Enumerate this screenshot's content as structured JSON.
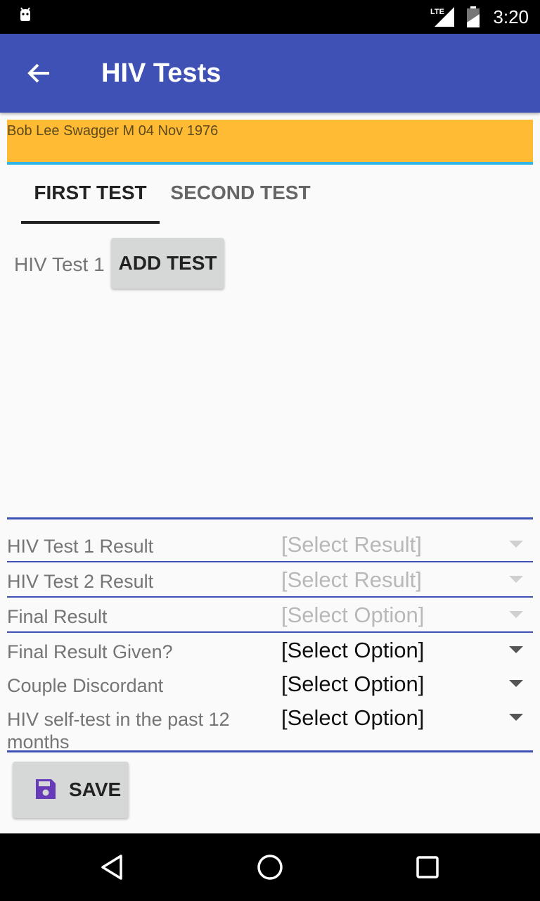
{
  "status_bar": {
    "network": "LTE",
    "time": "3:20"
  },
  "app_bar": {
    "title": "HIV Tests",
    "back_icon": "arrow-back-icon"
  },
  "patient": {
    "summary": "Bob Lee Swagger M 04 Nov 1976"
  },
  "tabs": [
    {
      "label": "FIRST TEST",
      "selected": true
    },
    {
      "label": "SECOND TEST",
      "selected": false
    }
  ],
  "test_section": {
    "label": "HIV Test 1",
    "add_button": "ADD TEST"
  },
  "form": {
    "rows": [
      {
        "label": "HIV Test 1 Result",
        "value": "[Select Result]",
        "enabled": false
      },
      {
        "label": "HIV Test 2 Result",
        "value": "[Select Result]",
        "enabled": false
      },
      {
        "label": "Final Result",
        "value": "[Select Option]",
        "enabled": false
      },
      {
        "label": "Final Result Given?",
        "value": "[Select Option]",
        "enabled": true
      },
      {
        "label": "Couple Discordant",
        "value": "[Select Option]",
        "enabled": true
      },
      {
        "label": "HIV self-test in the past 12 months",
        "value": "[Select Option]",
        "enabled": true
      }
    ]
  },
  "save": {
    "label": "SAVE",
    "icon": "save-icon"
  },
  "colors": {
    "primary": "#3f51b5",
    "banner": "#ffbb33",
    "banner_border": "#33b5e5",
    "save_icon": "#673ab7"
  }
}
